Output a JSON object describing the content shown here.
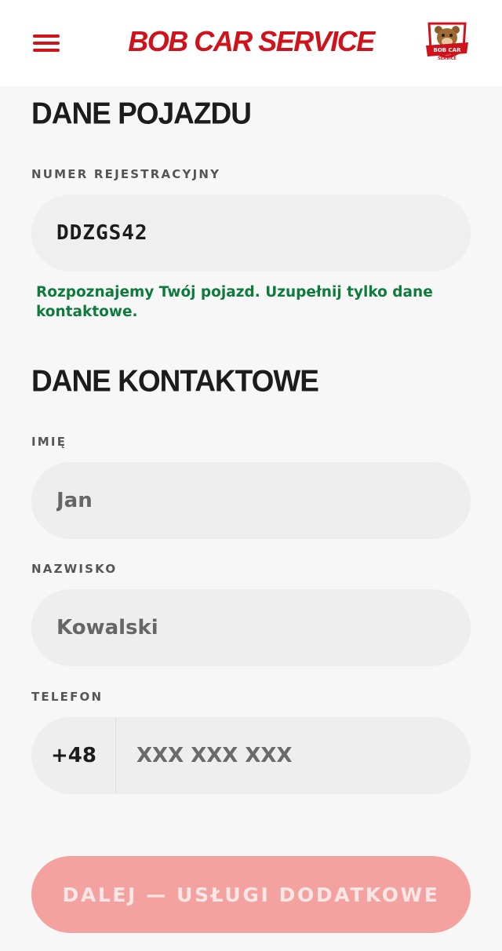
{
  "header": {
    "brand": "BOB CAR SERVICE",
    "menu_icon": "hamburger-menu-icon",
    "logo_icon": "bob-car-service-logo",
    "logo_text": "BOB CAR SERVICE",
    "accent_color": "#d0121b"
  },
  "vehicle": {
    "section_title": "DANE POJAZDU",
    "plate_label": "NUMER REJESTRACYJNY",
    "plate_value": "DDZGS42",
    "hint": "Rozpoznajemy Twój pojazd. Uzupełnij tylko dane kontaktowe.",
    "hint_color": "#0e7a3c"
  },
  "contact": {
    "section_title": "DANE KONTAKTOWE",
    "first_name_label": "IMIĘ",
    "first_name_placeholder": "Jan",
    "last_name_label": "NAZWISKO",
    "last_name_placeholder": "Kowalski",
    "phone_label": "TELEFON",
    "phone_prefix": "+48",
    "phone_placeholder": "XXX XXX XXX"
  },
  "actions": {
    "next_label": "DALEJ — USŁUGI DODATKOWE",
    "next_color": "#f4a2a0"
  }
}
